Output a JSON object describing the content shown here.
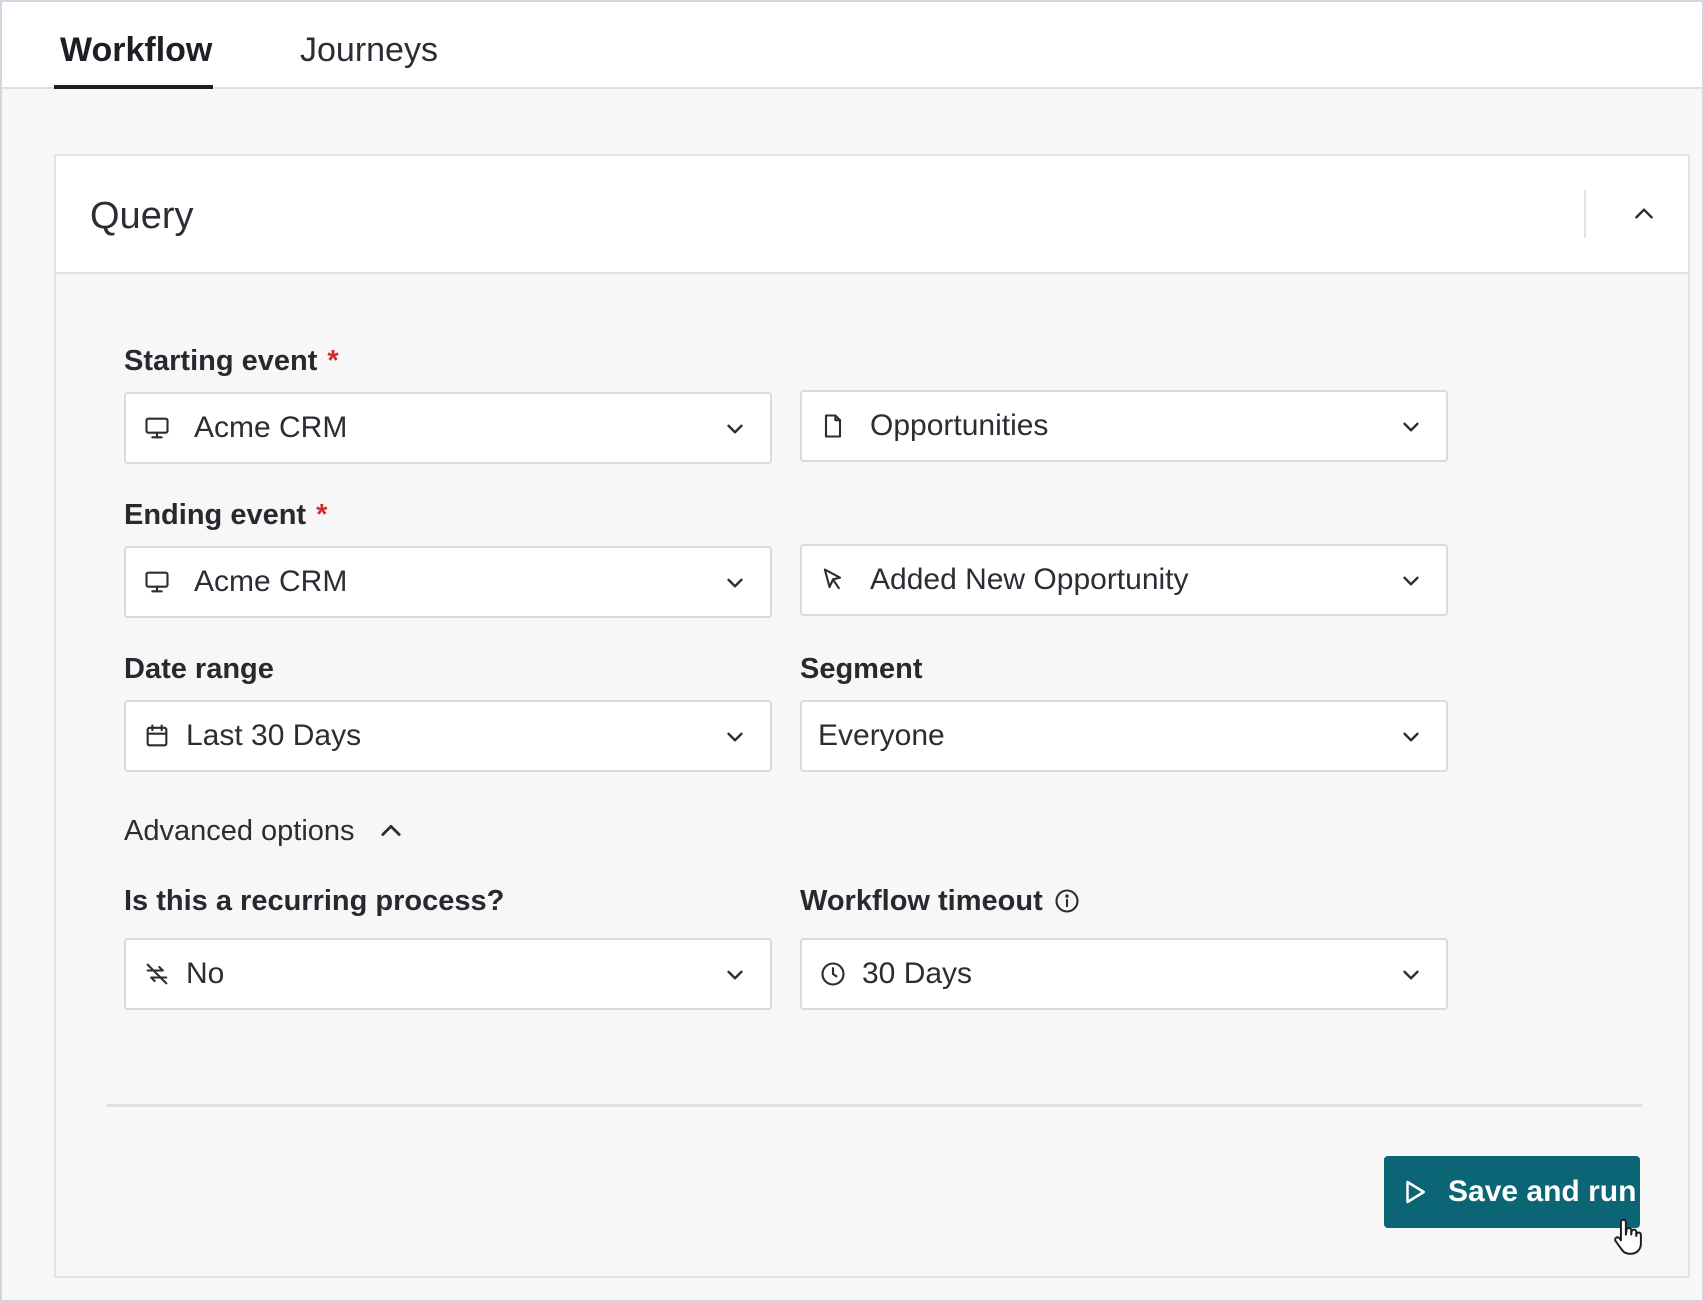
{
  "tabs": [
    {
      "label": "Workflow",
      "active": true
    },
    {
      "label": "Journeys",
      "active": false
    }
  ],
  "card": {
    "title": "Query"
  },
  "fields": {
    "starting_event": {
      "label": "Starting event",
      "required_mark": "*",
      "source": {
        "value": "Acme CRM",
        "icon": "monitor-icon"
      },
      "object": {
        "value": "Opportunities",
        "icon": "document-icon"
      }
    },
    "ending_event": {
      "label": "Ending event",
      "required_mark": "*",
      "source": {
        "value": "Acme CRM",
        "icon": "monitor-icon"
      },
      "action": {
        "value": "Added New Opportunity",
        "icon": "pointer-icon"
      }
    },
    "date_range": {
      "label": "Date range",
      "value": "Last 30 Days",
      "icon": "calendar-icon"
    },
    "segment": {
      "label": "Segment",
      "value": "Everyone"
    },
    "advanced_options": {
      "label": "Advanced options",
      "expanded": true
    },
    "recurring": {
      "label": "Is this a recurring process?",
      "value": "No",
      "icon": "no-repeat-icon"
    },
    "timeout": {
      "label": "Workflow timeout",
      "value": "30 Days",
      "icon": "clock-icon"
    }
  },
  "actions": {
    "save_and_run": "Save and run"
  },
  "colors": {
    "primary": "#0b6574",
    "required": "#d12c2c",
    "border": "#d9dadf",
    "background": "#f7f7f8"
  }
}
